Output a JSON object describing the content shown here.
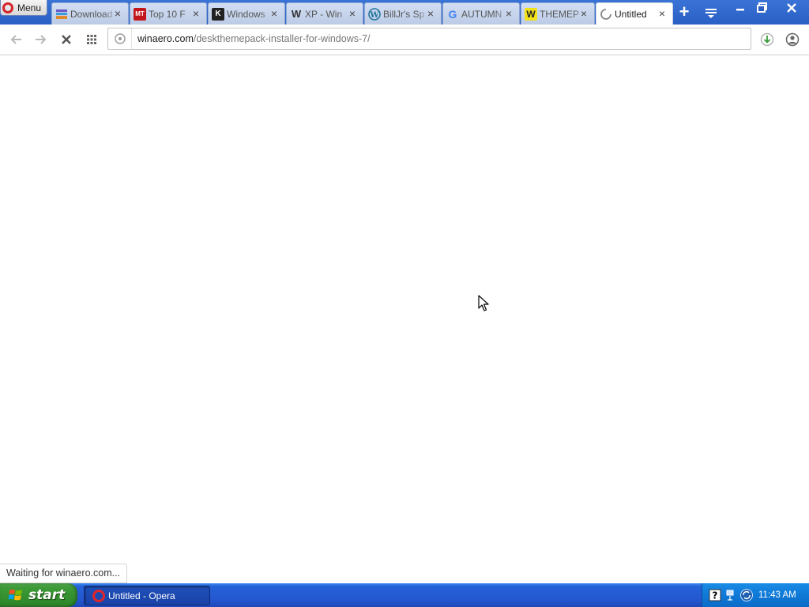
{
  "browser": {
    "menu_label": "Menu",
    "tabs": [
      {
        "title": "Download",
        "favicon": "grid-favicon",
        "close": "×"
      },
      {
        "title": "Top 10 F",
        "favicon": "mt-favicon",
        "favicon_text": "MT",
        "close": "×"
      },
      {
        "title": "Windows",
        "favicon": "k-favicon",
        "favicon_text": "K",
        "close": "×"
      },
      {
        "title": "XP - Win",
        "favicon": "w-favicon",
        "favicon_text": "W",
        "close": "×"
      },
      {
        "title": "BillJr's Sp",
        "favicon": "wordpress-favicon",
        "close": "×"
      },
      {
        "title": "AUTUMN",
        "favicon": "google-favicon",
        "favicon_text": "G",
        "close": "×"
      },
      {
        "title": "THEMEP",
        "favicon": "winaero-favicon",
        "favicon_text": "W",
        "close": "×"
      },
      {
        "title": "Untitled",
        "favicon": "loading-spinner",
        "close": "×",
        "active": true
      }
    ],
    "new_tab_label": "+",
    "address": {
      "host": "winaero.com",
      "path": "/deskthemepack-installer-for-windows-7/"
    },
    "status_text": "Waiting for winaero.com..."
  },
  "taskbar": {
    "start_label": "start",
    "window_item_label": "Untitled - Opera",
    "clock": "11:43 AM"
  },
  "colors": {
    "taskbar_blue": "#2457cf",
    "start_green": "#3c9a36",
    "tab_strip_blue": "#3a73d6",
    "opera_red": "#d6232a"
  }
}
